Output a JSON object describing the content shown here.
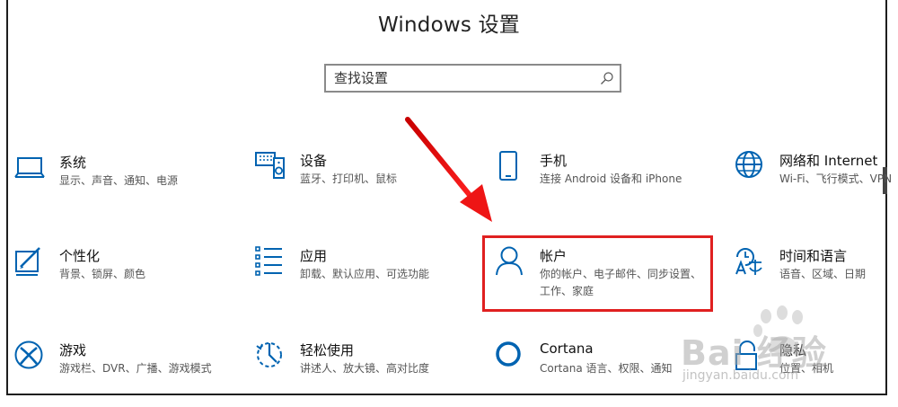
{
  "window": {
    "title": "Windows 设置"
  },
  "search": {
    "placeholder": "查找设置"
  },
  "tiles": [
    {
      "name": "系统",
      "desc": "显示、声音、通知、电源",
      "icon": "laptop-icon"
    },
    {
      "name": "设备",
      "desc": "蓝牙、打印机、鼠标",
      "icon": "devices-icon"
    },
    {
      "name": "手机",
      "desc": "连接 Android 设备和 iPhone",
      "icon": "phone-icon"
    },
    {
      "name": "网络和 Internet",
      "desc": "Wi-Fi、飞行模式、VPN",
      "icon": "globe-icon"
    },
    {
      "name": "个性化",
      "desc": "背景、锁屏、颜色",
      "icon": "personalization-icon"
    },
    {
      "name": "应用",
      "desc": "卸载、默认应用、可选功能",
      "icon": "apps-list-icon"
    },
    {
      "name": "帐户",
      "desc": "你的帐户、电子邮件、同步设置、工作、家庭",
      "icon": "account-person-icon"
    },
    {
      "name": "时间和语言",
      "desc": "语音、区域、日期",
      "icon": "time-language-icon"
    },
    {
      "name": "游戏",
      "desc": "游戏栏、DVR、广播、游戏模式",
      "icon": "xbox-icon"
    },
    {
      "name": "轻松使用",
      "desc": "讲述人、放大镜、高对比度",
      "icon": "ease-of-access-icon"
    },
    {
      "name": "Cortana",
      "desc": "Cortana 语言、权限、通知",
      "icon": "cortana-icon"
    },
    {
      "name": "隐私",
      "desc": "位置、相机",
      "icon": "lock-icon"
    }
  ],
  "watermark": {
    "brand": "Bai 经验",
    "url": "jingyan.baidu.com"
  },
  "colors": {
    "accent": "#0063b1",
    "highlight": "#e02020",
    "arrow": "#e01010"
  }
}
